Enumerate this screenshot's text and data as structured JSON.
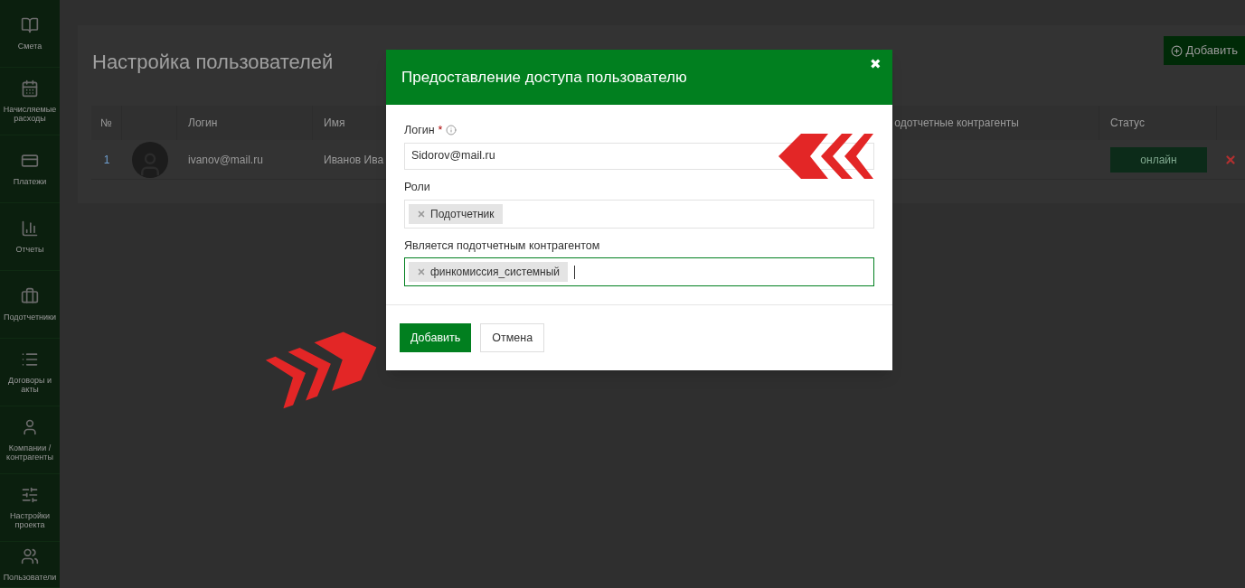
{
  "sidebar": {
    "items": [
      {
        "label": "Смета"
      },
      {
        "label": "Начисляемые расходы"
      },
      {
        "label": "Платежи"
      },
      {
        "label": "Отчеты"
      },
      {
        "label": "Подотчетники"
      },
      {
        "label": "Договоры и акты"
      },
      {
        "label": "Компании / контрагенты"
      },
      {
        "label": "Настройки проекта"
      },
      {
        "label": "Пользователи"
      }
    ]
  },
  "page": {
    "title": "Настройка пользователей",
    "add_button": "Добавить"
  },
  "table": {
    "columns": [
      "№",
      "",
      "Логин",
      "Имя",
      "одотчетные контрагенты",
      "Статус"
    ],
    "rows": [
      {
        "number": "1",
        "login": "ivanov@mail.ru",
        "name": "Иванов Ива",
        "status": "онлайн"
      }
    ]
  },
  "dialog": {
    "title": "Предоставление доступа пользователю",
    "close": "✖",
    "fields": [
      {
        "kind": "text",
        "label": "Логин",
        "required_mark": "*",
        "value": "Sidorov@mail.ru",
        "focused": false
      },
      {
        "kind": "tags",
        "label": "Роли",
        "tags": [
          "Подотчетник"
        ],
        "focused": false
      },
      {
        "kind": "tags",
        "label": "Является подотчетным контрагентом",
        "tags": [
          "финкомиссия_системный"
        ],
        "focused": true
      }
    ],
    "buttons": [
      {
        "label": "Добавить",
        "kind": "primary"
      },
      {
        "label": "Отмена",
        "kind": "secondary"
      }
    ]
  }
}
